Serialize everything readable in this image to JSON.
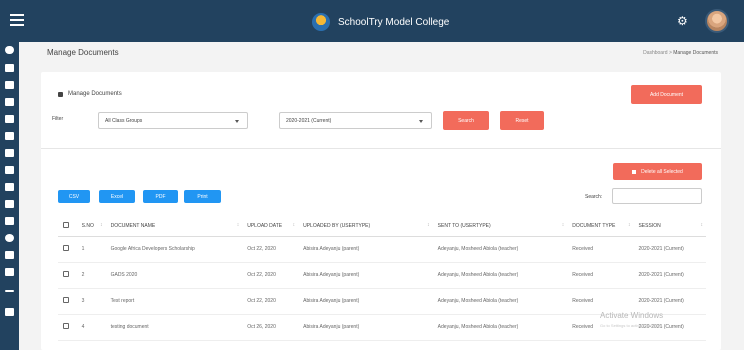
{
  "header": {
    "app_title": "SchoolTry Model College",
    "icons": {
      "menu": "hamburger-icon",
      "settings": "gear-icon",
      "user": "avatar"
    }
  },
  "sidebar": {
    "icons": [
      "cloud-icon",
      "user-icon",
      "users-icon",
      "hat-icon",
      "book-icon",
      "file-icon",
      "book-icon",
      "users-icon",
      "user-icon",
      "file-icon",
      "card-icon",
      "info-icon",
      "doc-icon",
      "monitor-icon",
      "minus-icon",
      "mail-icon"
    ]
  },
  "page": {
    "title": "Manage Documents",
    "breadcrumb": {
      "home": "Dashboard",
      "separator": ">",
      "current": "Manage Documents"
    }
  },
  "card": {
    "title": "Manage Documents",
    "add_button": "Add Document",
    "filter": {
      "label": "Filter",
      "class_group": {
        "value": "All Class Groups"
      },
      "session": {
        "value": "2020-2021 (Current)"
      },
      "search_button": "Search",
      "reset_button": "Reset"
    },
    "delete_all_button": "Delete all Selected",
    "export_buttons": [
      "CSV",
      "Excel",
      "PDF",
      "Print"
    ],
    "search_label": "Search:"
  },
  "table": {
    "columns": [
      "S.NO",
      "DOCUMENT NAME",
      "UPLOAD DATE",
      "UPLOADED BY (USERTYPE)",
      "SENT TO (USERTYPE)",
      "DOCUMENT TYPE",
      "SESSION"
    ],
    "rows": [
      {
        "sno": "1",
        "name": "Google Africa Developers Scholarship",
        "date": "Oct 22, 2020",
        "by": "Abisira Adeyanju (parent)",
        "to": "Adeyanju, Mosheed Abiola (teacher)",
        "type": "Received",
        "session": "2020-2021 (Current)"
      },
      {
        "sno": "2",
        "name": "GADS 2020",
        "date": "Oct 22, 2020",
        "by": "Abisira Adeyanju (parent)",
        "to": "Adeyanju, Mosheed Abiola (teacher)",
        "type": "Received",
        "session": "2020-2021 (Current)"
      },
      {
        "sno": "3",
        "name": "Test report",
        "date": "Oct 22, 2020",
        "by": "Abisira Adeyanju (parent)",
        "to": "Adeyanju, Mosheed Abiola (teacher)",
        "type": "Received",
        "session": "2020-2021 (Current)"
      },
      {
        "sno": "4",
        "name": "testing document",
        "date": "Oct 26, 2020",
        "by": "Abisira Adeyanju (parent)",
        "to": "Adeyanju, Mosheed Abiola (teacher)",
        "type": "Received",
        "session": "2020-2021 (Current)"
      }
    ]
  },
  "watermark": {
    "line1": "Activate Windows",
    "line2": "Go to Settings to activate Windows."
  }
}
